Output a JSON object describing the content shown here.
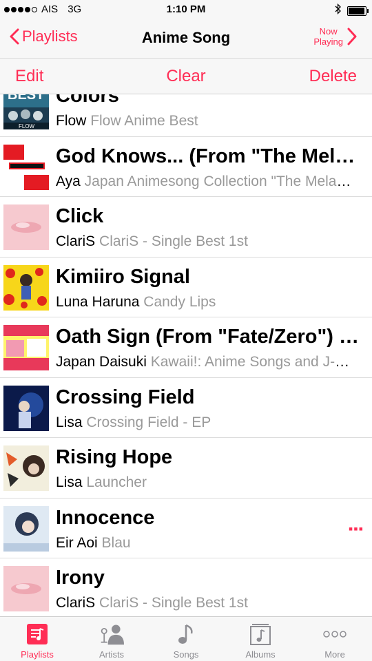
{
  "status_bar": {
    "carrier": "AIS",
    "network": "3G",
    "time": "1:10 PM",
    "battery_level": 0.95
  },
  "nav": {
    "back_label": "Playlists",
    "title": "Anime Song",
    "now_playing_line1": "Now",
    "now_playing_line2": "Playing"
  },
  "actions": {
    "edit": "Edit",
    "clear": "Clear",
    "delete": "Delete"
  },
  "songs": [
    {
      "title": "Colors",
      "artist": "Flow",
      "album": "Flow Anime Best",
      "art": "dark-blue-cover"
    },
    {
      "title": "God Knows... (From \"The Melancholy of Haruhi Suzumiya\")",
      "artist": "Aya",
      "album": "Japan Animesong Collection \"The Melancholy\"",
      "art": "red-white-cover"
    },
    {
      "title": "Click",
      "artist": "ClariS",
      "album": "ClariS - Single Best 1st",
      "art": "pink-cover"
    },
    {
      "title": "Kimiiro Signal",
      "artist": "Luna Haruna",
      "album": "Candy Lips",
      "art": "yellow-red-cover"
    },
    {
      "title": "Oath Sign (From \"Fate/Zero\") [TV Size]",
      "artist": "Japan Daisuki",
      "album": "Kawaii!: Anime Songs and J-Pops",
      "art": "kawaii-cover"
    },
    {
      "title": "Crossing Field",
      "artist": "Lisa",
      "album": "Crossing Field - EP",
      "art": "blue-cover"
    },
    {
      "title": "Rising Hope",
      "artist": "Lisa",
      "album": "Launcher",
      "art": "graffiti-cover"
    },
    {
      "title": "Innocence",
      "artist": "Eir Aoi",
      "album": "Blau",
      "art": "light-blue-cover"
    },
    {
      "title": "Irony",
      "artist": "ClariS",
      "album": "ClariS - Single Best 1st",
      "art": "pink-cover"
    }
  ],
  "tabs": [
    {
      "label": "Playlists",
      "icon": "playlists-icon"
    },
    {
      "label": "Artists",
      "icon": "artists-icon"
    },
    {
      "label": "Songs",
      "icon": "songs-icon"
    },
    {
      "label": "Albums",
      "icon": "albums-icon"
    },
    {
      "label": "More",
      "icon": "more-icon"
    }
  ],
  "colors": {
    "accent": "#ff2d55",
    "secondary_text": "#999999",
    "bar_background": "#f7f7f7"
  }
}
